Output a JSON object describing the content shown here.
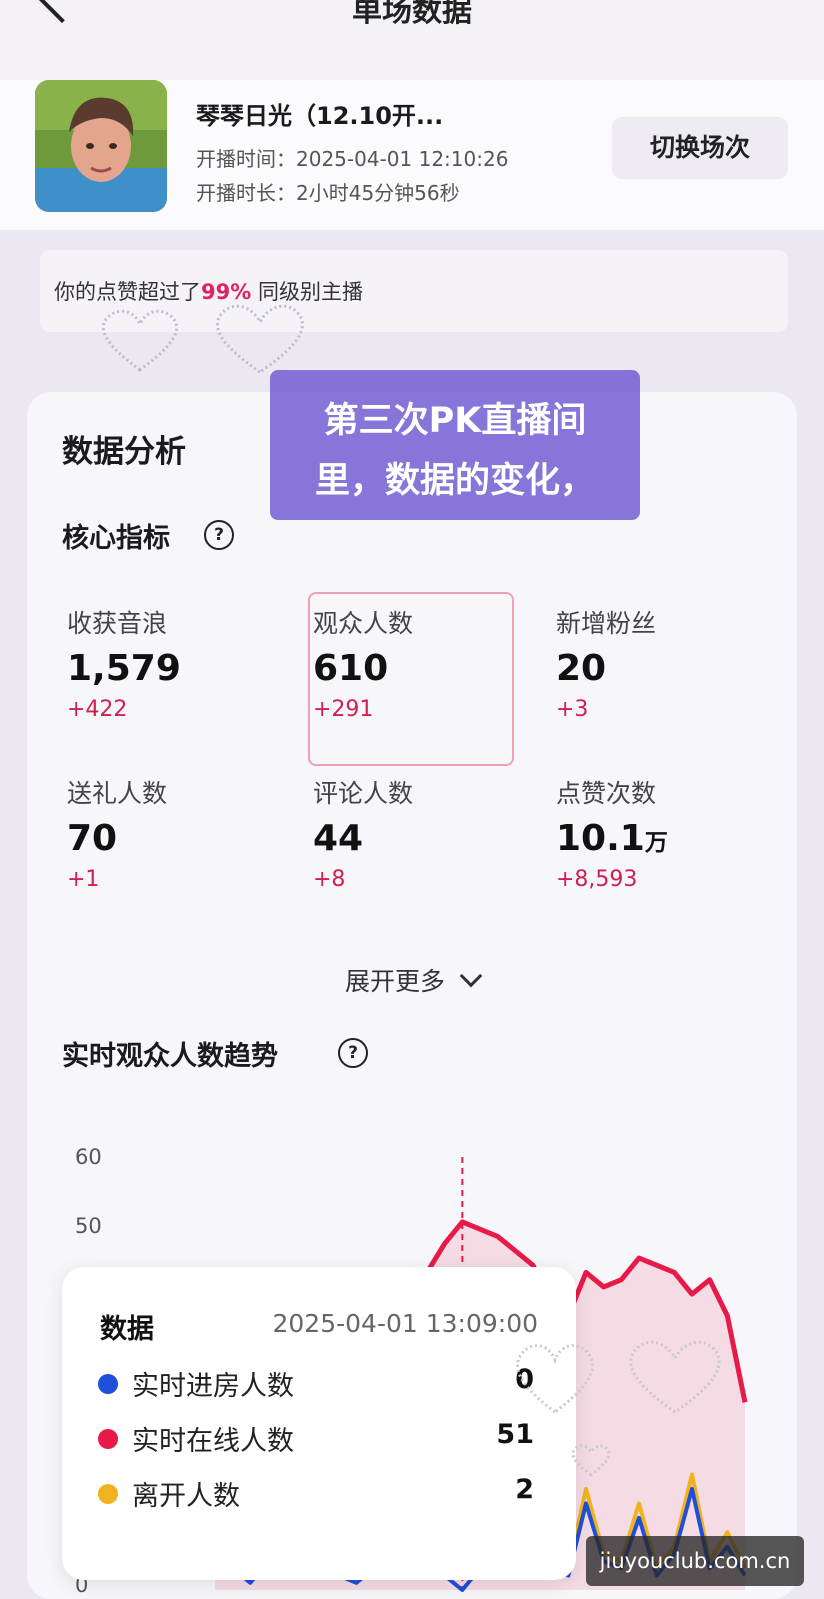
{
  "nav": {
    "title": "单场数据"
  },
  "header": {
    "name": "琴琴日光（12.10开...",
    "start_label": "开播时间：",
    "start_value": "2025-04-01 12:10:26",
    "duration_label": "开播时长：",
    "duration_value": "2小时45分钟56秒",
    "switch_button": "切换场次"
  },
  "notice": {
    "prefix": "你的点赞超过了",
    "percent": "99%",
    "suffix": " 同级别主播"
  },
  "overlay_caption": {
    "line1": "第三次PK直播间",
    "line2": "里，数据的变化，"
  },
  "analysis": {
    "title": "数据分析",
    "core_title": "核心指标",
    "metrics": [
      {
        "label": "收获音浪",
        "value": "1,579",
        "delta": "+422"
      },
      {
        "label": "观众人数",
        "value": "610",
        "delta": "+291"
      },
      {
        "label": "新增粉丝",
        "value": "20",
        "delta": "+3"
      },
      {
        "label": "送礼人数",
        "value": "70",
        "delta": "+1"
      },
      {
        "label": "评论人数",
        "value": "44",
        "delta": "+8"
      },
      {
        "label": "点赞次数",
        "value": "10.1",
        "unit": "万",
        "delta": "+8,593"
      }
    ],
    "selected_metric": "观众人数",
    "expand_label": "展开更多"
  },
  "trend": {
    "title": "实时观众人数趋势",
    "tooltip": {
      "heading": "数据",
      "date": "2025-04-01 13:09:00",
      "rows": [
        {
          "label": "实时进房人数",
          "value": "0",
          "color": "#1f4fd8"
        },
        {
          "label": "实时在线人数",
          "value": "51",
          "color": "#e81a47"
        },
        {
          "label": "离开人数",
          "value": "2",
          "color": "#f2b21d"
        }
      ]
    }
  },
  "chart_data": {
    "type": "line",
    "yticks": [
      "60",
      "50",
      "0"
    ],
    "ylim": [
      0,
      60
    ],
    "series": [
      {
        "name": "实时进房人数",
        "color": "#1f4fd8",
        "values": [
          2,
          3,
          1,
          4,
          2,
          3,
          5,
          2,
          1,
          3,
          2,
          4,
          3,
          2,
          0,
          3,
          2,
          4,
          8,
          3,
          2,
          12,
          4,
          3,
          10,
          2,
          5,
          14,
          3,
          6,
          2
        ]
      },
      {
        "name": "实时在线人数",
        "color": "#e81a47",
        "values": [
          5,
          8,
          10,
          14,
          18,
          22,
          25,
          28,
          30,
          33,
          36,
          40,
          44,
          48,
          51,
          50,
          49,
          47,
          45,
          40,
          38,
          44,
          42,
          43,
          46,
          45,
          44,
          41,
          43,
          38,
          26
        ]
      },
      {
        "name": "离开人数",
        "color": "#f2b21d",
        "values": [
          3,
          4,
          2,
          5,
          3,
          4,
          6,
          3,
          2,
          4,
          3,
          5,
          4,
          3,
          2,
          4,
          3,
          6,
          9,
          4,
          3,
          14,
          5,
          4,
          12,
          3,
          6,
          16,
          4,
          8,
          3
        ]
      }
    ]
  },
  "watermark": "jiuyouclub.com.cn"
}
